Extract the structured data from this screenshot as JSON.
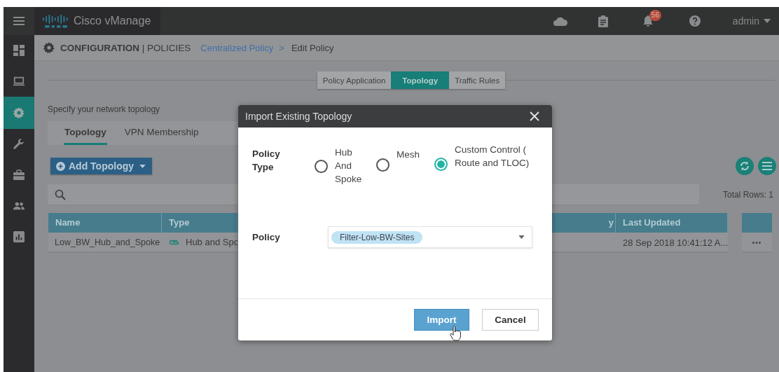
{
  "topbar": {
    "brand": "Cisco vManage",
    "notification_count": "56",
    "user": "admin"
  },
  "sidebar": {
    "items": [
      {
        "selected": false
      },
      {
        "selected": false
      },
      {
        "selected": true
      },
      {
        "selected": false
      },
      {
        "selected": false
      },
      {
        "selected": false
      },
      {
        "selected": false
      }
    ]
  },
  "breadcrumb": {
    "section": "**CONFIGURATION** | POLICIES",
    "link": "Centralized Policy",
    "separator": ">",
    "current": "Edit Policy"
  },
  "step_tabs": [
    {
      "label": "Policy Application",
      "selected": false
    },
    {
      "label": "Topology",
      "selected": true
    },
    {
      "label": "Traffic Rules",
      "selected": false
    }
  ],
  "instructions": "Specify your network topology",
  "sub_tabs": [
    {
      "label": "Topology",
      "selected": true
    },
    {
      "label": "VPN Membership",
      "selected": false
    }
  ],
  "add_button": "Add Topology",
  "total_rows": "Total Rows: 1",
  "table": {
    "columns": [
      {
        "label": "Name"
      },
      {
        "label": "Type"
      },
      {
        "label": "y"
      },
      {
        "label": "Last Updated"
      }
    ],
    "rows": [
      {
        "name": "Low_BW_Hub_and_Spoke",
        "type": "Hub and Spo",
        "last_updated": "28 Sep 2018 10:41:12 A...",
        "actions": "•••"
      }
    ]
  },
  "dialog": {
    "title": "Import Existing Topology",
    "policy_type_label": "Policy Type",
    "options": [
      {
        "label": "Hub And Spoke",
        "selected": false
      },
      {
        "label": "Mesh",
        "selected": false
      },
      {
        "label": "Custom Control ( Route and TLOC)",
        "selected": true
      }
    ],
    "policy_label": "Policy",
    "policy_value": "Filter-Low-BW-Sites",
    "buttons": [
      {
        "label": "Import",
        "kind": "primary"
      },
      {
        "label": "Cancel",
        "kind": "secondary"
      }
    ]
  }
}
